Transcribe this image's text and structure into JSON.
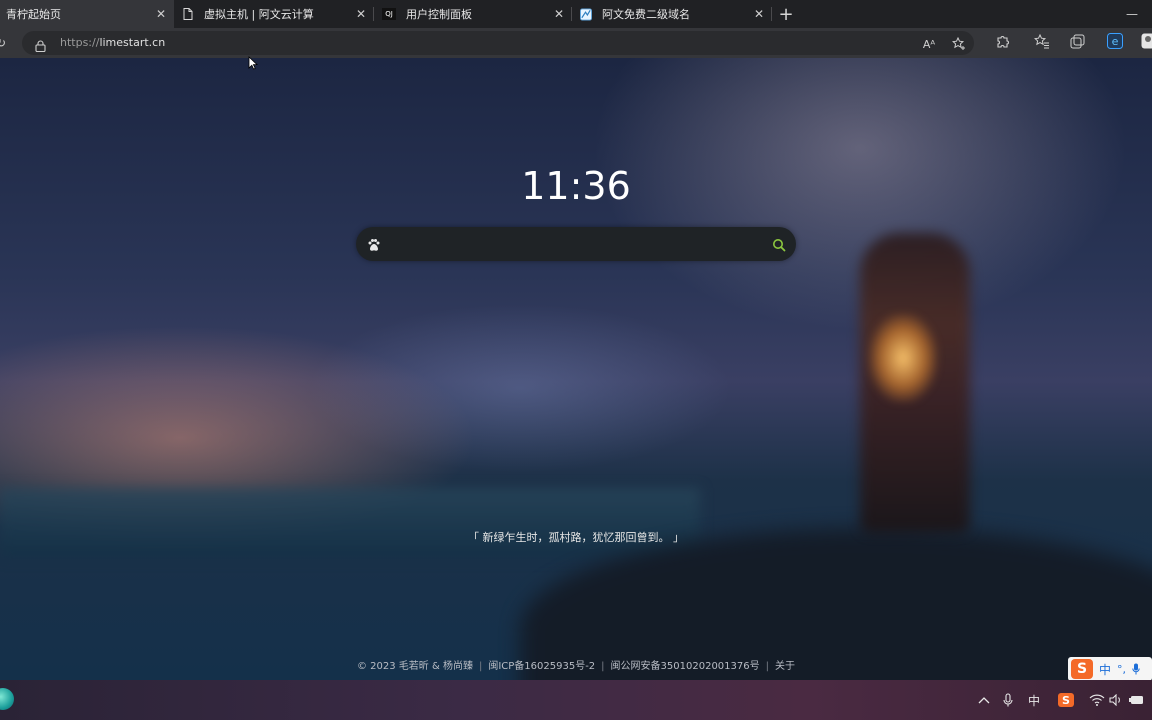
{
  "browser": {
    "tabs": [
      {
        "title": "青柠起始页",
        "icon": "blank",
        "active": true
      },
      {
        "title": "虚拟主机 | 阿文云计算",
        "icon": "page-icon"
      },
      {
        "title": "用户控制面板",
        "icon": "qj-icon",
        "icon_text": "QJ"
      },
      {
        "title": "阿文免费二级域名",
        "icon": "site-icon"
      }
    ],
    "new_tab_label": "+",
    "address": {
      "protocol": "https://",
      "host": "limestart.cn"
    },
    "read_aloud_label": "Aᴬ"
  },
  "page": {
    "clock": "11:36",
    "search": {
      "placeholder": "",
      "value": ""
    },
    "quote": "「 新绿乍生时，孤村路，犹忆那回曾到。 」",
    "footer": {
      "copyright": "© 2023 毛若昕 & 杨尚臻",
      "icp": "闽ICP备16025935号-2",
      "police": "闽公网安备35010202001376号",
      "about": "关于"
    }
  },
  "ime": {
    "logo": "S",
    "mode": "中",
    "punct": "°,"
  },
  "taskbar": {
    "ime_mode": "中"
  },
  "colors": {
    "search_accent": "#8cc63f",
    "ime_orange": "#f46a28",
    "ime_blue": "#1b6dd8"
  }
}
